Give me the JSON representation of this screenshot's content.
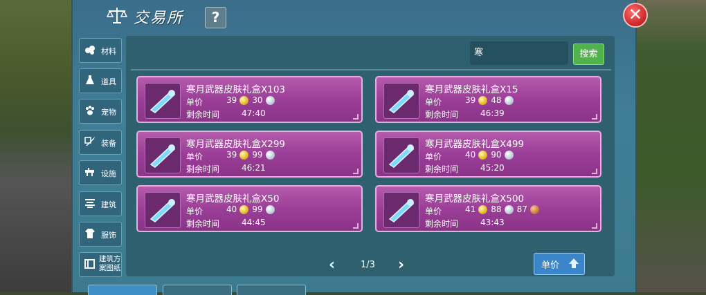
{
  "window": {
    "title": "交易所",
    "help_label": "?",
    "close_label": "✕"
  },
  "sidebar": {
    "items": [
      {
        "label": "材料",
        "icon": "material-icon"
      },
      {
        "label": "道具",
        "icon": "potion-icon"
      },
      {
        "label": "宠物",
        "icon": "paw-icon"
      },
      {
        "label": "装备",
        "icon": "sword-icon"
      },
      {
        "label": "设施",
        "icon": "facility-icon"
      },
      {
        "label": "建筑",
        "icon": "building-icon"
      },
      {
        "label": "服饰",
        "icon": "clothing-icon"
      },
      {
        "label": "建筑方案图纸",
        "icon": "blueprint-icon"
      }
    ]
  },
  "search": {
    "value": "寒",
    "button_label": "搜索"
  },
  "listing": {
    "price_label": "单价",
    "time_label": "剩余时间",
    "items": [
      {
        "name": "寒月武器皮肤礼盒X103",
        "gold": "39",
        "silver": "30",
        "copper": "",
        "time": "47:40"
      },
      {
        "name": "寒月武器皮肤礼盒X15",
        "gold": "39",
        "silver": "48",
        "copper": "",
        "time": "46:39"
      },
      {
        "name": "寒月武器皮肤礼盒X299",
        "gold": "39",
        "silver": "99",
        "copper": "",
        "time": "46:21"
      },
      {
        "name": "寒月武器皮肤礼盒X499",
        "gold": "40",
        "silver": "90",
        "copper": "",
        "time": "45:20"
      },
      {
        "name": "寒月武器皮肤礼盒X50",
        "gold": "40",
        "silver": "99",
        "copper": "",
        "time": "44:45"
      },
      {
        "name": "寒月武器皮肤礼盒X500",
        "gold": "41",
        "silver": "88",
        "copper": "87",
        "time": "43:43"
      }
    ]
  },
  "pager": {
    "text": "1/3",
    "prev": "‹",
    "next": "›"
  },
  "sort": {
    "label": "单价"
  },
  "colors": {
    "card": "#9b3e98",
    "panel": "#3f7f96",
    "search_button": "#4fb24a",
    "sort_button": "#3a86c8"
  }
}
